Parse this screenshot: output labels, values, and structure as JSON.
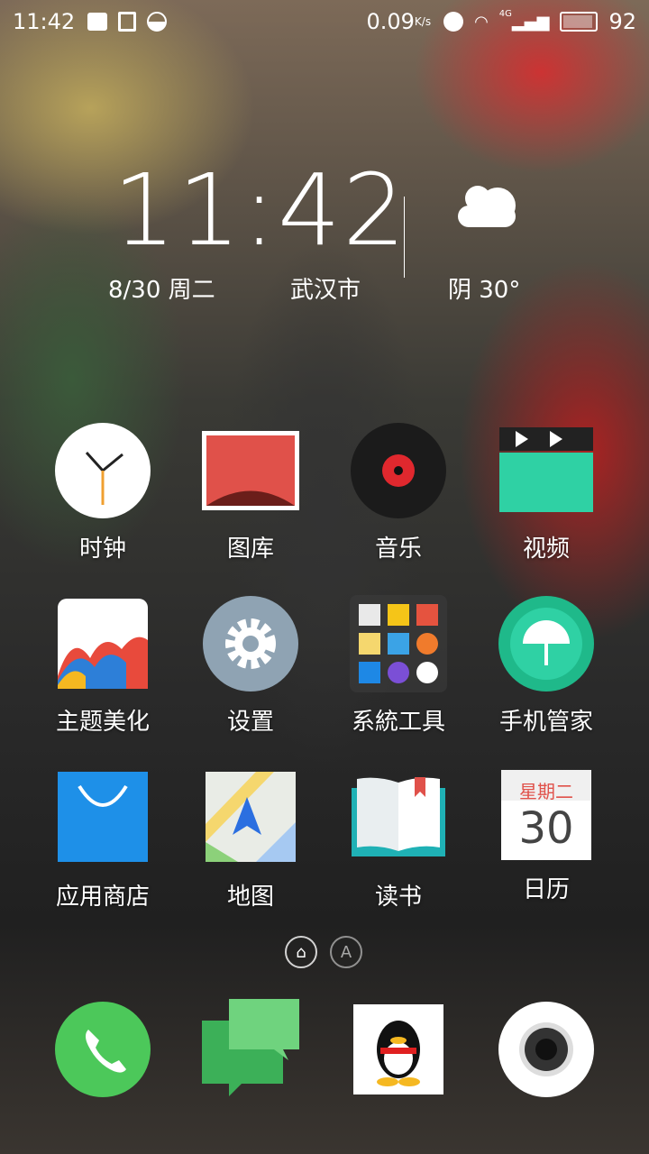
{
  "status_bar": {
    "time": "11:42",
    "net_speed": "0.09",
    "net_unit": "K/s",
    "network": "4G",
    "battery": "92"
  },
  "widget": {
    "time": "11:42",
    "date": "8/30 周二",
    "city": "武汉市",
    "weather": "阴 30°",
    "weather_icon": "cloudy-icon"
  },
  "apps": [
    {
      "label": "时钟",
      "icon": "clock-icon"
    },
    {
      "label": "图库",
      "icon": "gallery-icon"
    },
    {
      "label": "音乐",
      "icon": "music-icon"
    },
    {
      "label": "视频",
      "icon": "video-icon"
    },
    {
      "label": "主题美化",
      "icon": "theme-icon"
    },
    {
      "label": "设置",
      "icon": "settings-icon"
    },
    {
      "label": "系統工具",
      "icon": "folder-icon"
    },
    {
      "label": "手机管家",
      "icon": "security-icon"
    },
    {
      "label": "应用商店",
      "icon": "app-store-icon"
    },
    {
      "label": "地图",
      "icon": "map-icon"
    },
    {
      "label": "读书",
      "icon": "book-icon"
    },
    {
      "label": "日历",
      "icon": "calendar-icon",
      "weekday": "星期二",
      "day": "30"
    }
  ],
  "page_indicator": {
    "home": "⌂",
    "a": "A"
  },
  "dock": [
    {
      "icon": "phone-icon"
    },
    {
      "icon": "messages-icon"
    },
    {
      "icon": "qq-icon"
    },
    {
      "icon": "camera-icon"
    }
  ]
}
